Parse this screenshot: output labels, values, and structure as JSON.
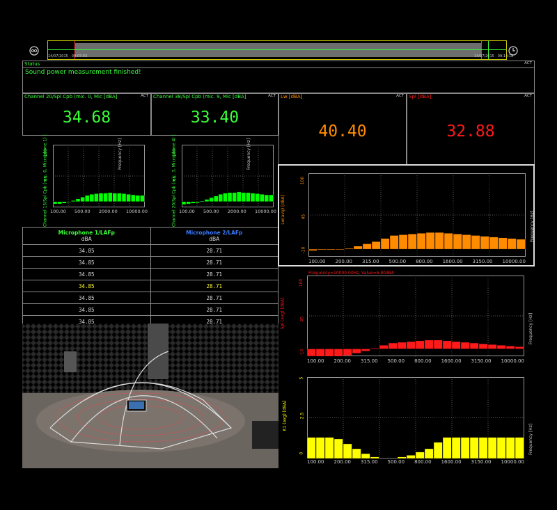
{
  "timeline": {
    "start_label": "14/07/2015 - 09:07:03",
    "end_label": "14/07/2015 - 09:14:18",
    "left_icon": "recorder-icon",
    "right_icon": "clock-icon"
  },
  "status": {
    "title": "Status",
    "act": "ACT",
    "message": "Sound power measurement finished!"
  },
  "numerics": [
    {
      "title": "Channel 20/Spl Cpb (mic. 0, Mic [dBA]",
      "value": "34.68",
      "act": "ACT",
      "color": "#39ff39"
    },
    {
      "title": "Channel 38/Spl Cpb (mic. 9, Mic [dBA]",
      "value": "33.40",
      "act": "ACT",
      "color": "#39ff39"
    },
    {
      "title": "Lw [dBA]",
      "value": "40.40",
      "act": "ACT",
      "color": "#ff8c00"
    },
    {
      "title": "Spl [dBA]",
      "value": "32.88",
      "act": "ACT",
      "color": "#ff1a1a"
    }
  ],
  "small_charts": [
    {
      "ylabel": "Channel 15/Spl Cpb (mic. 0, Microphone 1) (",
      "xlabel": "Frequency [Hz]",
      "yticks": [
        "100",
        "45"
      ],
      "xticks": [
        "100.00",
        "500.00",
        "2000.00",
        "10000.00"
      ]
    },
    {
      "ylabel": "Channel 20/Spl Cpb (mic. 3, Microphone 4) (",
      "xlabel": "Frequency [Hz]",
      "yticks": [
        "100",
        "45"
      ],
      "xticks": [
        "100.00",
        "500.00",
        "2000.00",
        "10000.00"
      ]
    }
  ],
  "mic_table": {
    "headers": [
      "Microphone 1/LAFp",
      "Microphone 2/LAFp"
    ],
    "header_colors": [
      "#39ff39",
      "#3a7bff"
    ],
    "units": [
      "dBA",
      "dBA"
    ],
    "rows": [
      [
        "34.85",
        "28.71"
      ],
      [
        "34.85",
        "28.71"
      ],
      [
        "34.85",
        "28.71"
      ],
      [
        "34.85",
        "28.71"
      ],
      [
        "34.85",
        "28.71"
      ],
      [
        "34.85",
        "28.71"
      ],
      [
        "34.85",
        "28.71"
      ]
    ],
    "highlight_row": 3,
    "highlight_color": "#ffff33"
  },
  "photo": {
    "label": "anechoic-chamber-photo"
  },
  "right_charts": {
    "lw": {
      "ylabel": "Lw(avg) [dBA]",
      "xlabel": "Frequency [Hz]",
      "yticks": [
        "100",
        "45",
        "-10"
      ]
    },
    "spl": {
      "ylabel": "Spl (avg) [dBA]",
      "xlabel": "Frequency [Hz]",
      "yticks": [
        "100",
        "45",
        "-10"
      ],
      "cursor_readout": "Frequency=10000.00Hz, Value=6.80dBA"
    },
    "k1": {
      "ylabel": "K1 (avg) [dBA]",
      "xlabel": "Frequency [Hz]",
      "yticks": [
        "5",
        "2.5",
        "0"
      ]
    },
    "xticks": [
      "100.00",
      "200.00",
      "315.00",
      "500.00",
      "800.00",
      "1600.00",
      "3150.00",
      "10000.00"
    ]
  },
  "chart_data": [
    {
      "type": "bar",
      "title": "",
      "ylabel": "Channel 15/Spl Cpb (mic. 0, Microphone 1) (",
      "xlabel": "Frequency [Hz]",
      "ylim": [
        -10,
        100
      ],
      "color": "#00ff00",
      "values": [
        -4,
        -4,
        -3,
        -1,
        2,
        5,
        8,
        11,
        13,
        14,
        15,
        15,
        16,
        15,
        15,
        14,
        13,
        12,
        11,
        11
      ]
    },
    {
      "type": "bar",
      "title": "",
      "ylabel": "Channel 20/Spl Cpb (mic. 3, Microphone 4) (",
      "xlabel": "Frequency [Hz]",
      "ylim": [
        -10,
        100
      ],
      "color": "#00ff00",
      "values": [
        -5,
        -4,
        -3,
        -2,
        1,
        4,
        7,
        10,
        13,
        15,
        16,
        16,
        17,
        16,
        16,
        15,
        14,
        13,
        12,
        12
      ]
    },
    {
      "type": "bar",
      "title": "",
      "ylabel": "Lw(avg) [dBA]",
      "xlabel": "Frequency [Hz]",
      "ylim": [
        -10,
        100
      ],
      "color": "#ff8c00",
      "values": [
        -2,
        -1,
        -1,
        0,
        1,
        4,
        7,
        10,
        14,
        18,
        19,
        20,
        21,
        22,
        22,
        21,
        20,
        19,
        18,
        17,
        16,
        15,
        14,
        13
      ]
    },
    {
      "type": "bar",
      "title": "",
      "ylabel": "Spl (avg) [dBA]",
      "xlabel": "Frequency [Hz]",
      "ylim": [
        -10,
        100
      ],
      "color": "#ff1a1a",
      "values": [
        -10,
        -11,
        -12,
        -11,
        -9,
        -6,
        -3,
        1,
        5,
        8,
        9,
        10,
        11,
        12,
        12,
        11,
        10,
        9,
        8,
        7,
        6,
        5,
        4,
        3
      ]
    },
    {
      "type": "bar",
      "title": "",
      "ylabel": "K1 (avg) [dBA]",
      "xlabel": "Frequency [Hz]",
      "ylim": [
        0,
        5
      ],
      "color": "#ffff00",
      "values": [
        1.3,
        1.3,
        1.3,
        1.2,
        0.9,
        0.6,
        0.3,
        0.1,
        0.0,
        0.0,
        0.1,
        0.2,
        0.4,
        0.6,
        1.0,
        1.3,
        1.3,
        1.3,
        1.3,
        1.3,
        1.3,
        1.3,
        1.3,
        1.3
      ]
    }
  ]
}
